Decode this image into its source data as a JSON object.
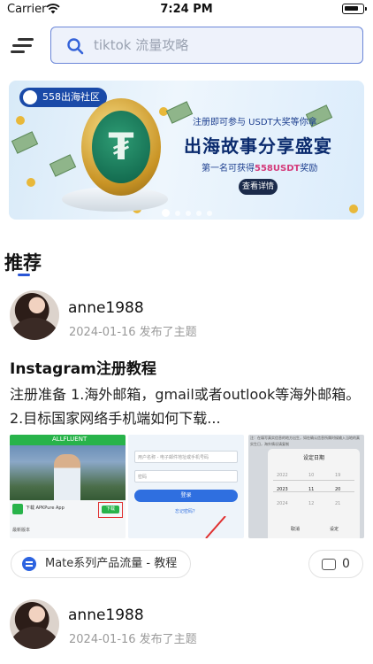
{
  "status_bar": {
    "carrier": "Carrier",
    "time": "7:24 PM"
  },
  "search": {
    "placeholder": "tiktok 流量攻略"
  },
  "banner": {
    "logo_text": "558出海社区",
    "line1": "注册即可参与  USDT大奖等你拿",
    "title": "出海故事分享盛宴",
    "line3_prefix": "第一名可获得",
    "line3_highlight": "558USDT",
    "line3_suffix": "奖励",
    "button_label": "查看详情",
    "slide_count": 5,
    "active_slide": 1
  },
  "section": {
    "title": "推荐"
  },
  "posts": [
    {
      "username": "anne1988",
      "meta": "2024-01-16  发布了主题",
      "title": "Instagram注册教程",
      "excerpt": "注册准备 1.海外邮箱，gmail或者outlook等海外邮箱。2.目标国家网络手机端如何下载...",
      "thumbnails": {
        "thumb1": {
          "app_name": "ALLFLUENT",
          "download_text": "下载 APKPure App",
          "install_label": "下载",
          "footer_text": "最新版本"
        },
        "thumb2": {
          "field1": "用户名称 - 电子邮件地址或手机号码",
          "field2": "密码",
          "login_label": "登录",
          "forgot_label": "忘记密码？"
        },
        "thumb3": {
          "header_text": "注：在填写真实信息的地方出生，如在确认信息所属时候输入当地的真实生日，海外情况请复制",
          "picker_title": "设定日期",
          "years": [
            "2022",
            "2023",
            "2024"
          ],
          "months": [
            "10",
            "11",
            "12"
          ],
          "days": [
            "19",
            "20",
            "21"
          ],
          "cancel_label": "取消",
          "confirm_label": "设定"
        }
      },
      "tag": "Mate系列产品流量 - 教程",
      "comments": "0"
    },
    {
      "username": "anne1988",
      "meta": "2024-01-16  发布了主题"
    }
  ]
}
